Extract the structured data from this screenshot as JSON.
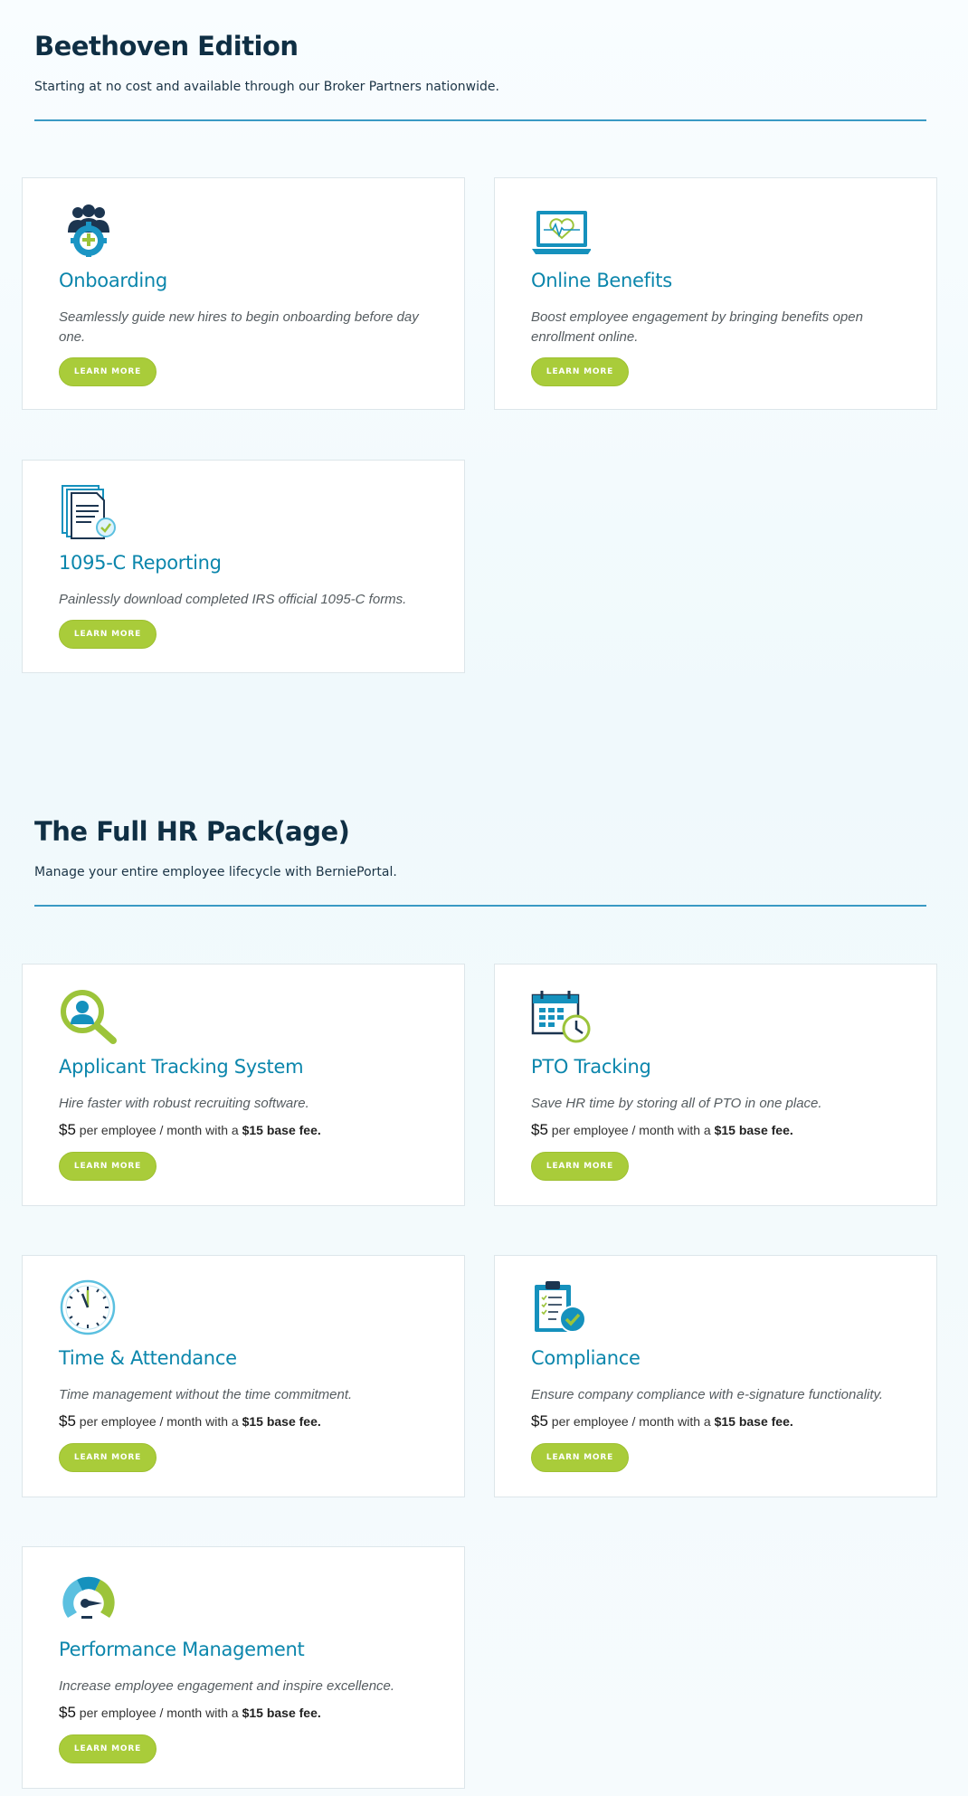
{
  "colors": {
    "heading": "#0f2f44",
    "card_title": "#0b86ac",
    "button": "#a9cc3a",
    "rule": "#3a9ac4"
  },
  "section1": {
    "title": "Beethoven Edition",
    "subtitle": "Starting at no cost and available through our Broker Partners nationwide.",
    "cards": [
      {
        "icon": "onboarding-team-gear-icon",
        "title": "Onboarding",
        "description": "Seamlessly guide new hires to begin onboarding before day one.",
        "button": "LEARN MORE"
      },
      {
        "icon": "laptop-heart-icon",
        "title": "Online Benefits",
        "description": "Boost employee engagement by bringing benefits open enrollment online.",
        "button": "LEARN MORE"
      },
      {
        "icon": "documents-check-icon",
        "title": "1095-C Reporting",
        "description": "Painlessly download completed IRS official 1095-C forms.",
        "button": "LEARN MORE"
      }
    ]
  },
  "section2": {
    "title": "The Full HR Pack(age)",
    "subtitle": "Manage your entire employee lifecycle with BerniePortal.",
    "price_amount": "$5",
    "price_mid": " per employee / month with a ",
    "price_fee": "$15 base fee.",
    "cards": [
      {
        "icon": "magnifier-person-icon",
        "title": "Applicant Tracking System",
        "description": "Hire faster with robust recruiting software.",
        "button": "LEARN MORE"
      },
      {
        "icon": "calendar-clock-icon",
        "title": "PTO Tracking",
        "description": "Save HR time by storing all of PTO in one place.",
        "button": "LEARN MORE"
      },
      {
        "icon": "clock-icon",
        "title": "Time & Attendance",
        "description": "Time management without the time commitment.",
        "button": "LEARN MORE"
      },
      {
        "icon": "clipboard-check-icon",
        "title": "Compliance",
        "description": "Ensure company compliance with e-signature functionality.",
        "button": "LEARN MORE"
      },
      {
        "icon": "speedometer-gauge-icon",
        "title": "Performance Management",
        "description": "Increase employee engagement and inspire excellence.",
        "button": "LEARN MORE"
      }
    ]
  }
}
